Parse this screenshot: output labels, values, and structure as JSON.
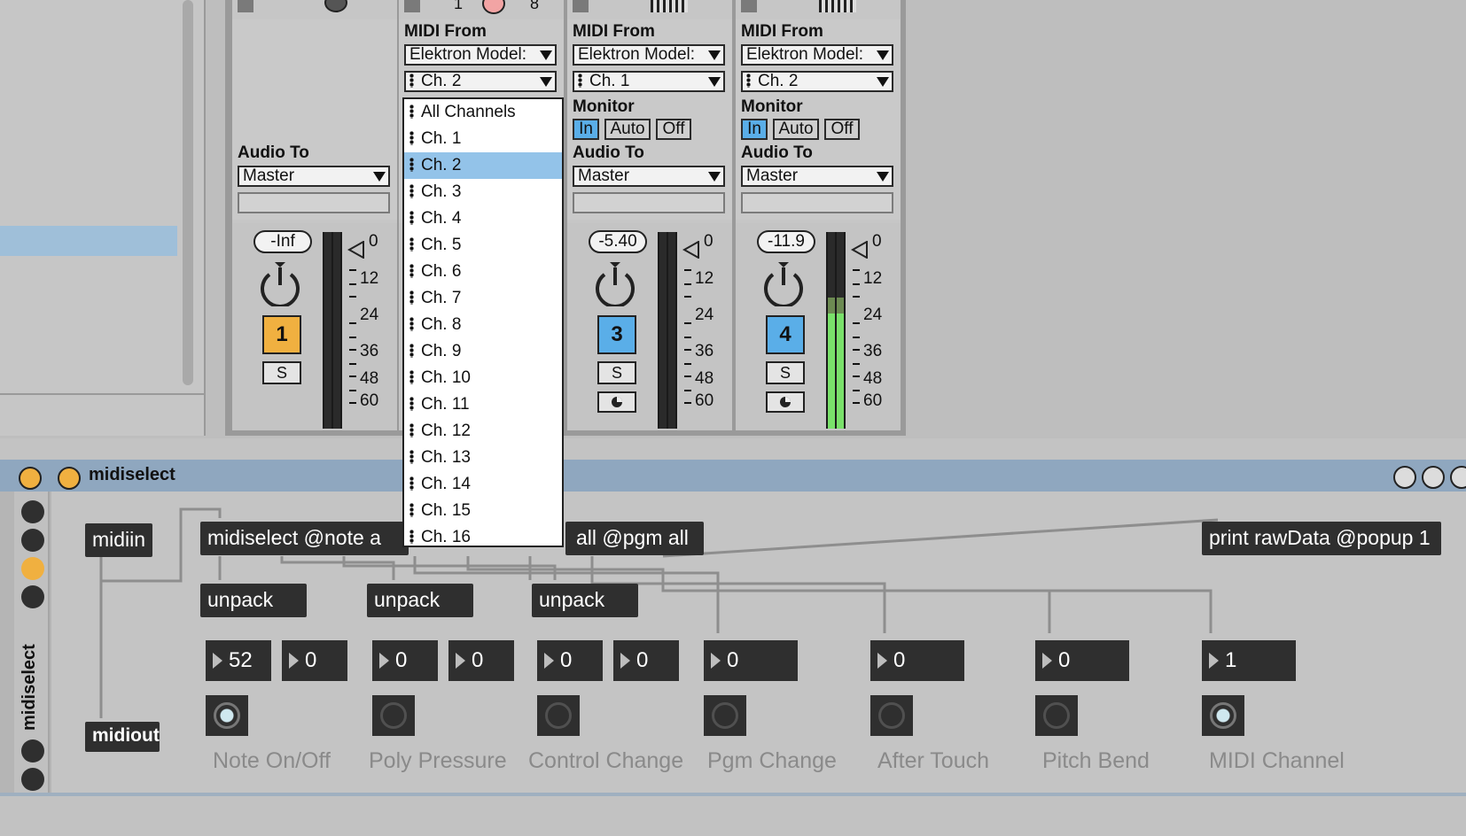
{
  "top_strip": {
    "numbers": [
      "1",
      "8"
    ]
  },
  "tracks": [
    {
      "audio_to_label": "Audio To",
      "audio_to_value": "Master",
      "volume": "-Inf",
      "number": "1",
      "solo": "S",
      "color": "#f0b040"
    },
    {
      "midi_from_label": "MIDI From",
      "midi_from_value": "Elektron Model:",
      "channel_value": "Ch. 2"
    },
    {
      "midi_from_label": "MIDI From",
      "midi_from_value": "Elektron Model:",
      "channel_value": "Ch. 1",
      "monitor_label": "Monitor",
      "monitor_in": "In",
      "monitor_auto": "Auto",
      "monitor_off": "Off",
      "audio_to_label": "Audio To",
      "audio_to_value": "Master",
      "volume": "-5.40",
      "number": "3",
      "solo": "S",
      "color": "#5aaee8"
    },
    {
      "midi_from_label": "MIDI From",
      "midi_from_value": "Elektron Model:",
      "channel_value": "Ch. 2",
      "monitor_label": "Monitor",
      "monitor_in": "In",
      "monitor_auto": "Auto",
      "monitor_off": "Off",
      "audio_to_label": "Audio To",
      "audio_to_value": "Master",
      "volume": "-11.9",
      "number": "4",
      "solo": "S",
      "color": "#5aaee8"
    }
  ],
  "meter_scale": [
    "0",
    "12",
    "24",
    "36",
    "48",
    "60"
  ],
  "channel_dropdown": {
    "selected": "Ch. 2",
    "items": [
      "All Channels",
      "Ch. 1",
      "Ch. 2",
      "Ch. 3",
      "Ch. 4",
      "Ch. 5",
      "Ch. 6",
      "Ch. 7",
      "Ch. 8",
      "Ch. 9",
      "Ch. 10",
      "Ch. 11",
      "Ch. 12",
      "Ch. 13",
      "Ch. 14",
      "Ch. 15",
      "Ch. 16"
    ]
  },
  "device": {
    "title": "midiselect",
    "side_title": "midiselect",
    "objects": {
      "midiin": "midiin",
      "midiout": "midiout",
      "midiselect_left": "midiselect @note a",
      "midiselect_right": "all @pgm all",
      "print": "print rawData @popup 1",
      "unpack": "unpack"
    },
    "number_boxes": [
      "52",
      "0",
      "0",
      "0",
      "0",
      "0",
      "0",
      "0",
      "0",
      "1"
    ],
    "toggles_on": [
      true,
      false,
      false,
      false,
      false,
      false,
      true
    ],
    "captions": [
      "Note On/Off",
      "Poly Pressure",
      "Control Change",
      "Pgm Change",
      "After Touch",
      "Pitch Bend",
      "MIDI Channel"
    ]
  }
}
